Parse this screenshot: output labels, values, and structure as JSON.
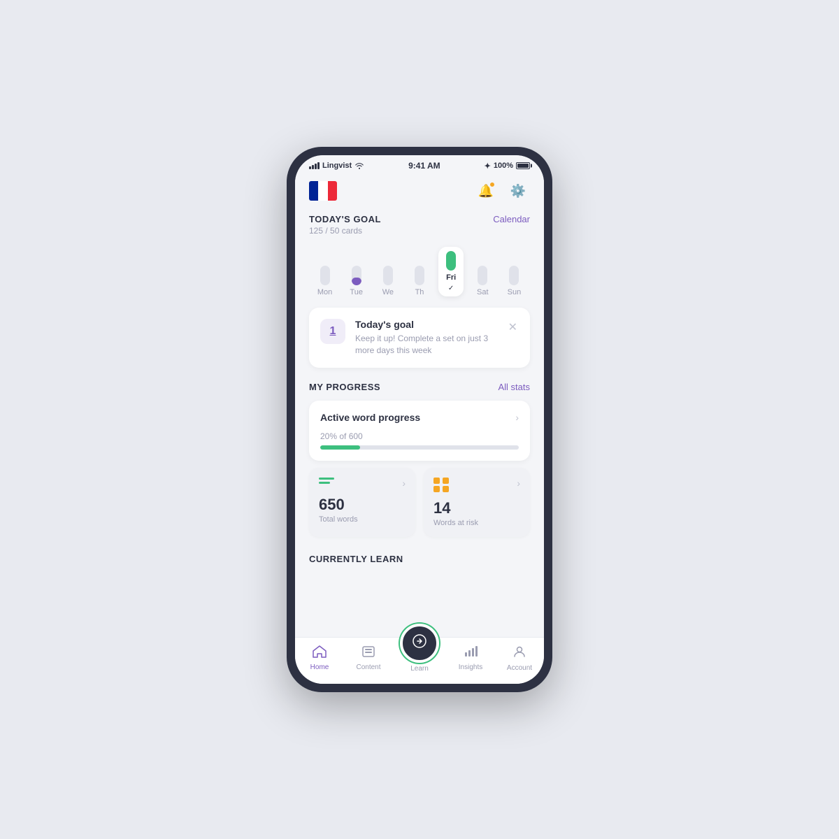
{
  "status": {
    "carrier": "Lingvist",
    "time": "9:41 AM",
    "battery": "100%"
  },
  "header": {
    "notification_icon": "🔔",
    "settings_icon": "⚙"
  },
  "todays_goal": {
    "title": "TODAY'S GOAL",
    "progress": "125 / 50 cards",
    "calendar_label": "Calendar"
  },
  "week": {
    "days": [
      {
        "label": "Mon",
        "fill": 0,
        "active": false,
        "today": false
      },
      {
        "label": "Tue",
        "fill": 40,
        "active": true,
        "today": false
      },
      {
        "label": "We",
        "fill": 0,
        "active": false,
        "today": false
      },
      {
        "label": "Th",
        "fill": 0,
        "active": false,
        "today": false
      },
      {
        "label": "Fri",
        "fill": 100,
        "active": true,
        "today": true
      },
      {
        "label": "Sat",
        "fill": 0,
        "active": false,
        "today": false
      },
      {
        "label": "Sun",
        "fill": 0,
        "active": false,
        "today": false
      }
    ]
  },
  "goal_card": {
    "number": "1",
    "title": "Today's goal",
    "description": "Keep it up! Complete a set on just 3 more days this week"
  },
  "my_progress": {
    "title": "MY PROGRESS",
    "all_stats_label": "All stats",
    "active_word_card": {
      "title": "Active word progress",
      "percent_label": "20% of 600",
      "fill_percent": 20
    },
    "stat_cards": [
      {
        "number": "650",
        "label": "Total words",
        "icon_type": "lines"
      },
      {
        "number": "14",
        "label": "Words at risk",
        "icon_type": "grid"
      }
    ]
  },
  "currently_learn": {
    "title": "CURRENTLY LEARN"
  },
  "bottom_nav": {
    "items": [
      {
        "label": "Home",
        "icon": "🏠",
        "active": true
      },
      {
        "label": "Content",
        "icon": "⊡",
        "active": false
      },
      {
        "label": "Learn",
        "icon": "⟳",
        "active": false,
        "fab": true
      },
      {
        "label": "Insights",
        "icon": "📊",
        "active": false
      },
      {
        "label": "Account",
        "icon": "👤",
        "active": false
      }
    ]
  },
  "colors": {
    "purple": "#7c5cbf",
    "green": "#3dbf7e",
    "orange": "#f5a623",
    "dark": "#2d3142",
    "light_bg": "#f4f5f8"
  }
}
